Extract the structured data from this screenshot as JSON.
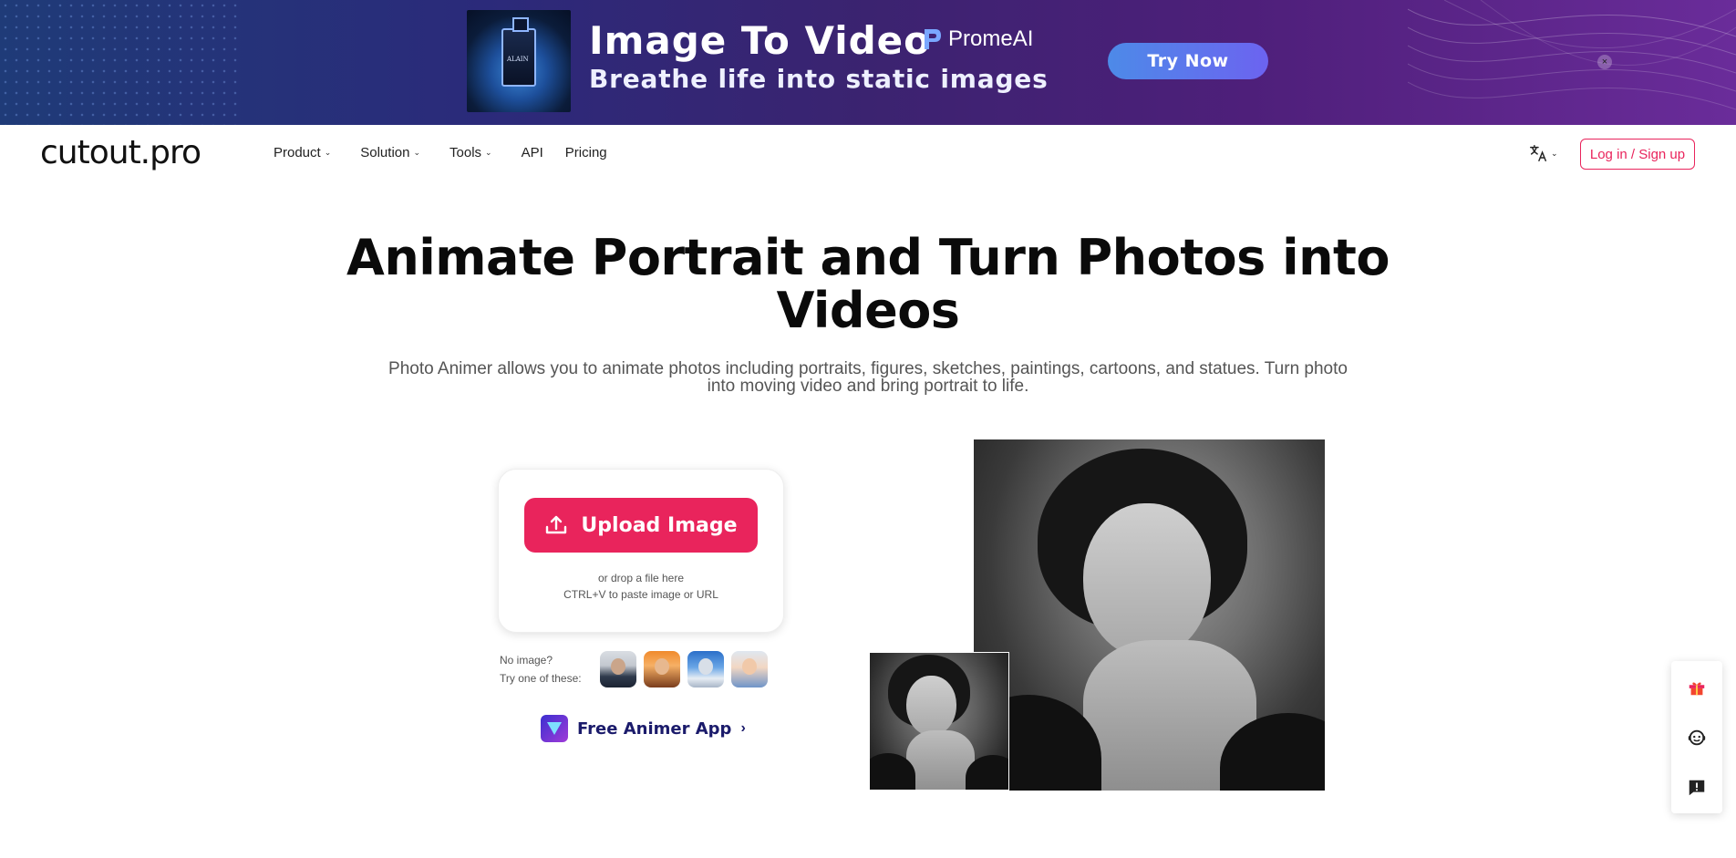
{
  "banner": {
    "title": "Image To Video",
    "subtitle": "Breathe life into static images",
    "brand": "PromeAI",
    "cta": "Try Now",
    "close_glyph": "×",
    "bottle_text": "ALAIN"
  },
  "nav": {
    "logo": "cutout.pro",
    "items": [
      {
        "label": "Product",
        "has_dropdown": true
      },
      {
        "label": "Solution",
        "has_dropdown": true
      },
      {
        "label": "Tools",
        "has_dropdown": true
      },
      {
        "label": "API",
        "has_dropdown": false
      },
      {
        "label": "Pricing",
        "has_dropdown": false
      }
    ],
    "chevron": "⌄",
    "language_icon": "translate-icon",
    "login": "Log in / Sign up"
  },
  "hero": {
    "title_line1": "Animate Portrait and Turn Photos into",
    "title_line2": "Videos",
    "description_line1": "Photo Animer allows you to animate photos including portraits, figures, sketches, paintings, cartoons, and statues. Turn photo",
    "description_line2": "into moving video and bring portrait to life."
  },
  "upload": {
    "button": "Upload Image",
    "hint_line1": "or drop a file here",
    "hint_line2": "CTRL+V to paste image or URL"
  },
  "samples": {
    "label_line1": "No image?",
    "label_line2": "Try one of these:"
  },
  "app": {
    "label": "Free Animer App",
    "chevron": "›"
  },
  "colors": {
    "accent": "#e9245c",
    "app_text": "#1b1b6b"
  }
}
